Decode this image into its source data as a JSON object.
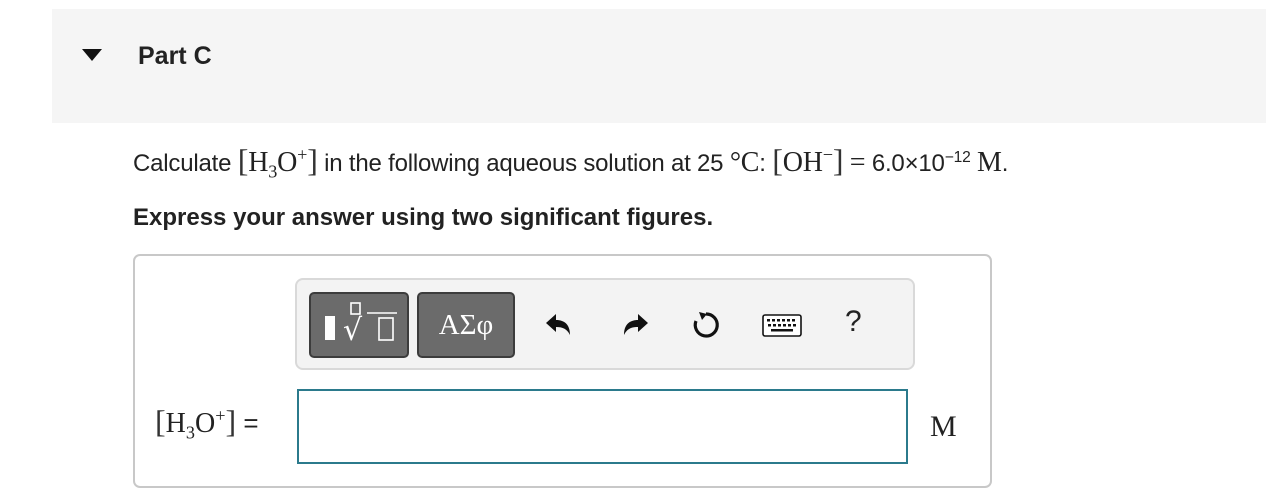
{
  "part": {
    "title": "Part C"
  },
  "question": {
    "prefix": "Calculate",
    "species_1": {
      "base": "H",
      "sub": "3",
      "rest": "O",
      "sup": "+"
    },
    "middle": "in the following aqueous solution at 25",
    "temp_unit": "°C",
    "colon": ":",
    "species_2": {
      "base": "OH",
      "sup": "−"
    },
    "equals": "=",
    "value": "6.0×10",
    "exponent": "−12",
    "unit": "M",
    "end": "."
  },
  "instruction": "Express your answer using two significant figures.",
  "toolbar": {
    "greek_label": "ΑΣφ",
    "help_label": "?",
    "icons": [
      "templates-icon",
      "undo-icon",
      "redo-icon",
      "reset-icon",
      "keyboard-icon"
    ]
  },
  "answer": {
    "label_base": "H",
    "label_sub": "3",
    "label_rest": "O",
    "label_sup": "+",
    "label_eq": "=",
    "value": "",
    "unit": "M"
  },
  "colors": {
    "input_border": "#2b7a8c",
    "button_bg": "#6b6b6b",
    "header_bg": "#f5f5f5"
  }
}
